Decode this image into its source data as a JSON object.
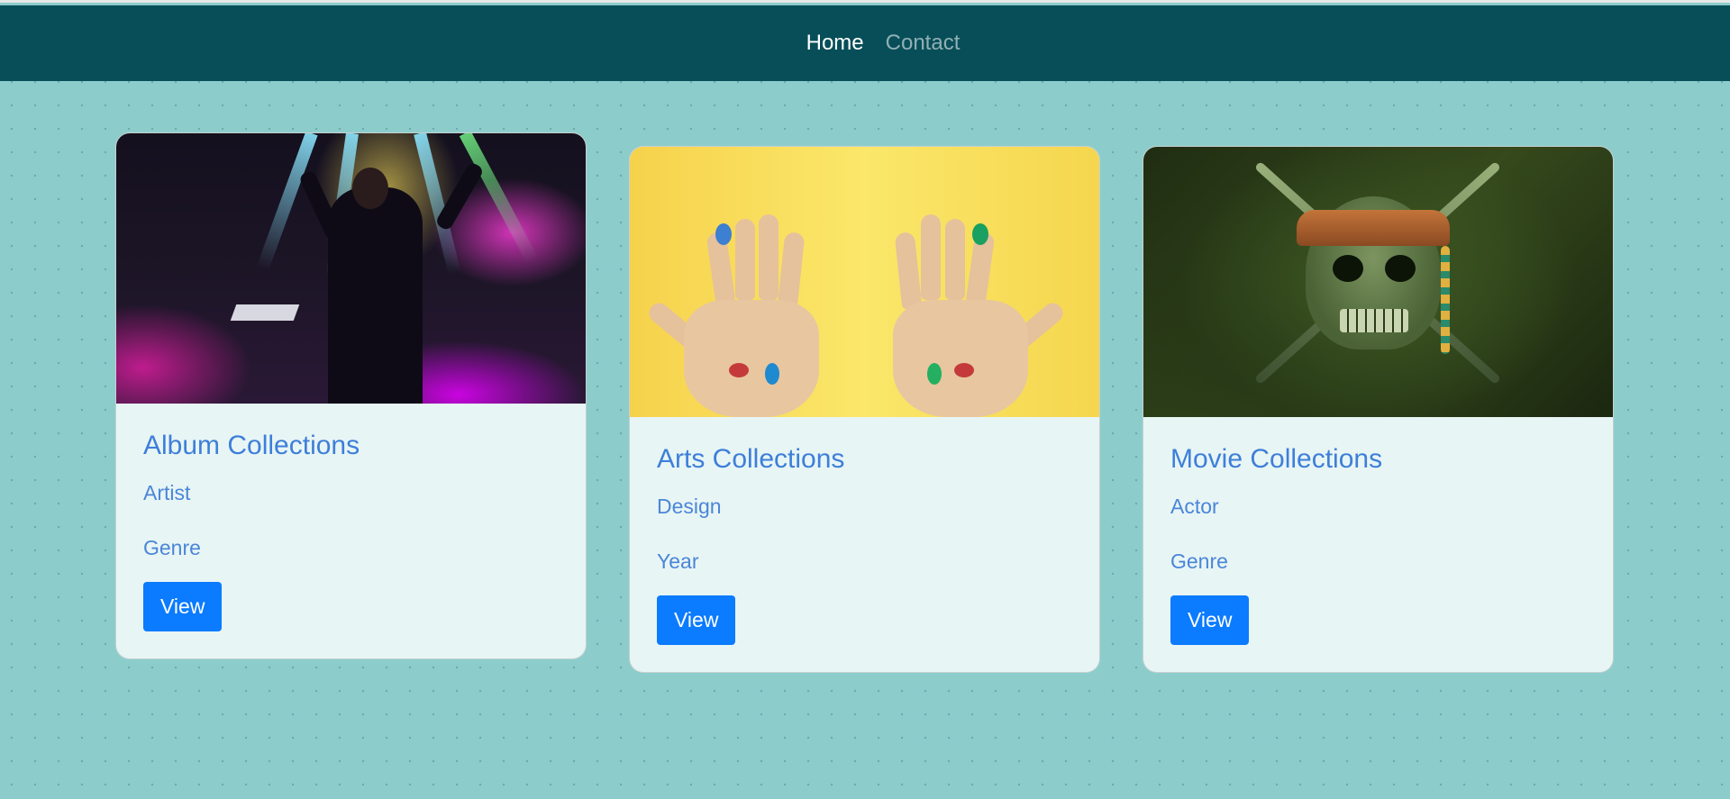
{
  "nav": {
    "items": [
      {
        "label": "Home",
        "active": true
      },
      {
        "label": "Contact",
        "active": false
      }
    ]
  },
  "cards": [
    {
      "title": "Album Collections",
      "line1": "Artist",
      "line2": "Genre",
      "button": "View",
      "image": "concert-photo"
    },
    {
      "title": "Arts Collections",
      "line1": "Design",
      "line2": "Year",
      "button": "View",
      "image": "painted-hands-photo"
    },
    {
      "title": "Movie Collections",
      "line1": "Actor",
      "line2": "Genre",
      "button": "View",
      "image": "pirate-skull-photo"
    }
  ],
  "colors": {
    "navbar": "#074e58",
    "background": "#8ccdcc",
    "card": "#e8f5f5",
    "title": "#3d7fd9",
    "button": "#0b7bff"
  }
}
